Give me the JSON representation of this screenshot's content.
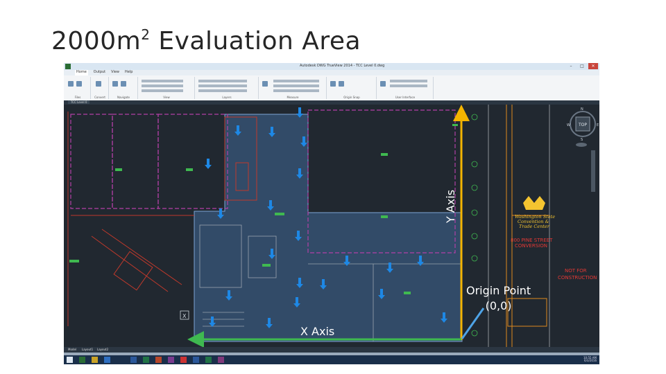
{
  "slide": {
    "title_main": "2000m",
    "title_sup": "2",
    "title_rest": " Evaluation Area"
  },
  "window": {
    "title": "Autodesk DWG TrueView 2014 - TCC Level 0.dwg",
    "menu": [
      "Home",
      "Output",
      "View",
      "Help"
    ],
    "ribbon_groups": [
      "Files",
      "Convert",
      "Navigate",
      "View",
      "Layers",
      "Measure",
      "Origin Snap",
      "User Interface"
    ],
    "doc_tab": "TCC Level 0",
    "layout_tabs": [
      "Model",
      "Layout1",
      "Layout2"
    ]
  },
  "drawing": {
    "viewcube_labels": [
      "N",
      "W",
      "TOP",
      "E",
      "S"
    ],
    "logo_text": [
      "Washington State",
      "Convention &",
      "Trade Center"
    ],
    "conversion_text": [
      "800 PINE STREET",
      "CONVERSION"
    ],
    "stamp_text": [
      "NOT FOR",
      "CONSTRUCTION"
    ],
    "x_marker": "X"
  },
  "annotations": {
    "y_axis_label": "Y Axis",
    "x_axis_label": "X Axis",
    "origin_label_line1": "Origin Point",
    "origin_label_line2": "(0,0)"
  },
  "colors": {
    "y_axis": "#f4b400",
    "x_axis": "#3fb950",
    "origin_pointer": "#4ea3e6",
    "area_fill": "#3a5a80",
    "boundary_magenta": "#b23fa6",
    "boundary_red": "#c0392b",
    "arrow_blue": "#1e88e5"
  },
  "taskbar": {
    "clock_time": "10:55 AM",
    "clock_date": "6/3/2016"
  }
}
